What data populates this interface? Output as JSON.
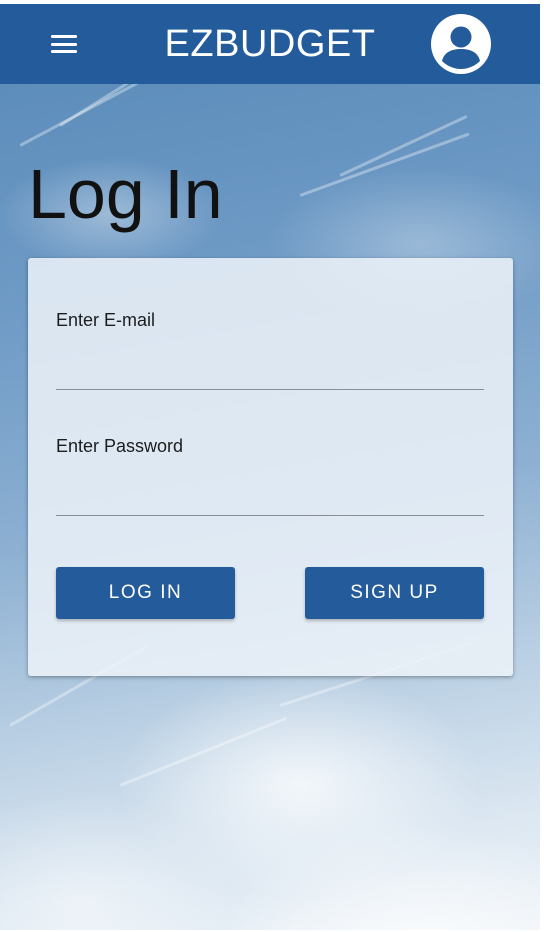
{
  "app_bar": {
    "title": "EZBUDGET",
    "color": "#235b9b",
    "menu_icon": "hamburger-menu-icon",
    "avatar_icon": "account-circle-icon"
  },
  "page": {
    "title": "Log In"
  },
  "login_form": {
    "email_label": "Enter E-mail",
    "email_value": "",
    "password_label": "Enter Password",
    "password_value": "",
    "login_label": "LOG IN",
    "signup_label": "SIGN UP"
  }
}
